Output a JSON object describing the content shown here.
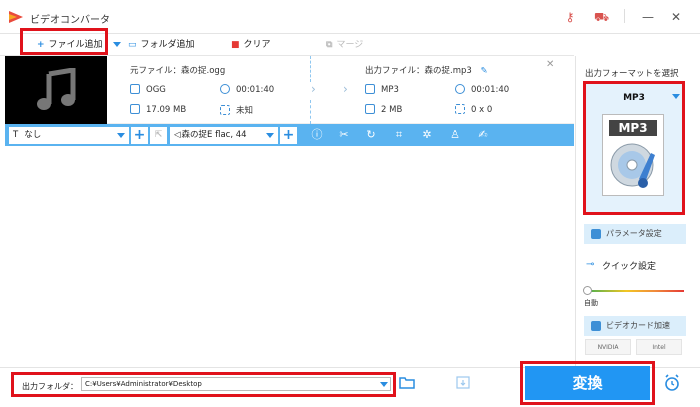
{
  "app": {
    "title": "ビデオコンバータ"
  },
  "toolbar": {
    "add_file": "ファイル追加",
    "add_folder": "フォルダ追加",
    "clear": "クリア",
    "merge": "マージ"
  },
  "file": {
    "source_label": "元ファイル：",
    "source_name": "森の捉.ogg",
    "output_label": "出力ファイル：",
    "output_name": "森の捉.mp3",
    "source_format": "OGG",
    "source_duration": "00:01:40",
    "source_size": "17.09 MB",
    "source_resolution": "未知",
    "output_format": "MP3",
    "output_duration": "00:01:40",
    "output_size": "2 MB",
    "output_resolution": "0 x 0"
  },
  "actionbar": {
    "subtitle": "なし",
    "audio_track": "森の捉E flac, 44"
  },
  "right_panel": {
    "format_title": "出力フォーマットを選択",
    "format_name": "MP3",
    "format_card_text": "MP3",
    "params_button": "パラメータ設定",
    "quick_settings": "クイック設定",
    "auto_label": "自動",
    "gpu_button": "ビデオカード加速",
    "nvidia": "NVIDIA",
    "intel": "Intel"
  },
  "bottom": {
    "output_folder_label": "出力フォルダ：",
    "output_folder_path": "C:¥Users¥Administrator¥Desktop",
    "convert_button": "変換"
  },
  "colors": {
    "accent": "#2196f3",
    "action_bar": "#5ab3f0",
    "highlight_red": "#e0121b"
  }
}
